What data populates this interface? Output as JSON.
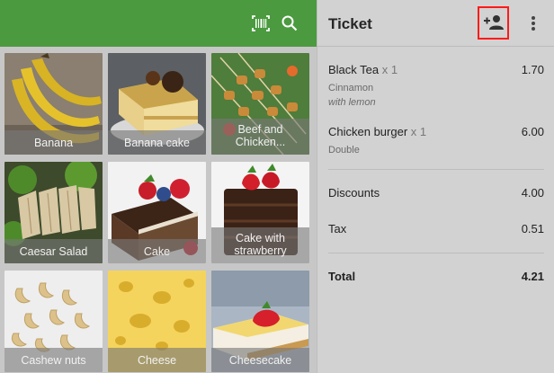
{
  "toolbar": {
    "barcode_icon": "barcode-scan-icon",
    "search_icon": "search-icon"
  },
  "items": [
    {
      "label": "Banana"
    },
    {
      "label": "Banana cake"
    },
    {
      "label": "Beef and Chicken..."
    },
    {
      "label": "Caesar Salad"
    },
    {
      "label": "Cake"
    },
    {
      "label": "Cake with strawberry"
    },
    {
      "label": "Cashew nuts"
    },
    {
      "label": "Cheese"
    },
    {
      "label": "Cheesecake"
    }
  ],
  "ticket": {
    "title": "Ticket",
    "add_customer_icon": "add-customer-icon",
    "more_icon": "more-vert-icon",
    "lines": [
      {
        "name": "Black Tea",
        "qty": "x 1",
        "price": "1.70",
        "modifiers": [
          "Cinnamon"
        ],
        "comment": "with lemon"
      },
      {
        "name": "Chicken burger",
        "qty": "x 1",
        "price": "6.00",
        "modifiers": [
          "Double"
        ],
        "comment": ""
      }
    ],
    "discounts_label": "Discounts",
    "discounts_value": "4.00",
    "tax_label": "Tax",
    "tax_value": "0.51",
    "total_label": "Total",
    "total_value": "4.21"
  },
  "colors": {
    "toolbar_green": "#4b9a3f",
    "highlight_red": "#ff1a1a"
  }
}
